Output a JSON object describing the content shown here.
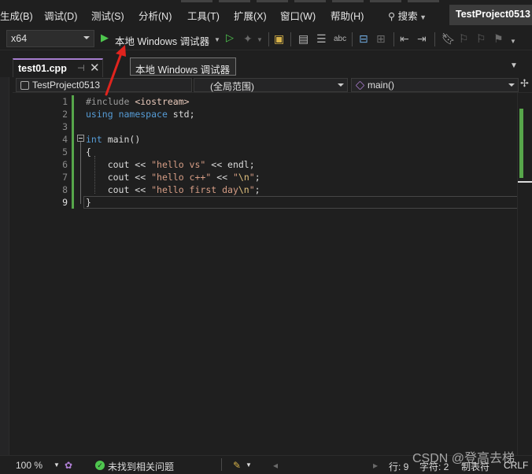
{
  "menu": {
    "items": [
      "生成(B)",
      "调试(D)",
      "测试(S)",
      "分析(N)",
      "工具(T)",
      "扩展(X)",
      "窗口(W)",
      "帮助(H)"
    ],
    "search_label": "搜索",
    "project_title": "TestProject0513"
  },
  "toolbar": {
    "platform": "x64",
    "run_label": "本地 Windows 调试器"
  },
  "tooltip": "本地 Windows 调试器",
  "tabs": [
    {
      "label": "test01.cpp",
      "active": true
    }
  ],
  "navbar": {
    "project": "TestProject0513",
    "scope": "(全局范围)",
    "member": "main()"
  },
  "editor": {
    "line_numbers": [
      "1",
      "2",
      "3",
      "4",
      "5",
      "6",
      "7",
      "8",
      "9"
    ],
    "current_line": 9
  },
  "statusbar": {
    "zoom": "100 %",
    "issues": "未找到相关问题",
    "line": "行: 9",
    "char": "字符: 2",
    "tabs": "制表符",
    "eol": "CRLF"
  },
  "watermark": "CSDN @登高去梯",
  "colors": {
    "accent_purple": "#a67dcf",
    "change_green": "#57a64a",
    "keyword_blue": "#569cd6",
    "string_brown": "#d69d85",
    "annotation_red": "#e0241e"
  }
}
